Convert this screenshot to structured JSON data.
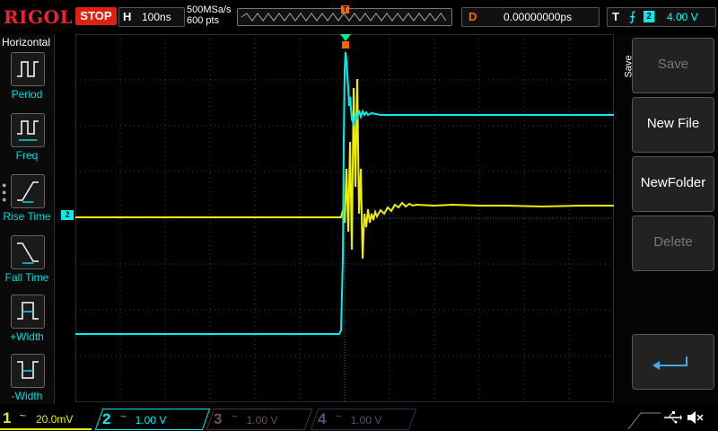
{
  "brand": "RIGOL",
  "run_state": "STOP",
  "horizontal": {
    "label": "H",
    "timebase": "100ns",
    "sample_rate": "500MSa/s",
    "points": "600  pts"
  },
  "trigger_position_marker": "T",
  "delay": {
    "label": "D",
    "value": "0.00000000ps"
  },
  "trigger": {
    "label": "T",
    "edge_icon": "rising-edge-icon",
    "source": "2",
    "level": "4.00 V"
  },
  "left_menu": {
    "title": "Horizontal",
    "items": [
      {
        "label": "Period",
        "icon": "period-icon"
      },
      {
        "label": "Freq",
        "icon": "freq-icon"
      },
      {
        "label": "Rise Time",
        "icon": "rise-time-icon"
      },
      {
        "label": "Fall Time",
        "icon": "fall-time-icon"
      },
      {
        "label": "+Width",
        "icon": "positive-width-icon"
      },
      {
        "label": "-Width",
        "icon": "negative-width-icon"
      }
    ]
  },
  "ch2_marker": "2",
  "right_menu": {
    "title": "Save",
    "items": [
      {
        "label": "Save",
        "enabled": false
      },
      {
        "label": "New File",
        "enabled": true
      },
      {
        "label": "NewFolder",
        "enabled": true
      },
      {
        "label": "Delete",
        "enabled": false
      }
    ],
    "return_icon": "return-arrow-icon"
  },
  "channels": [
    {
      "num": "1",
      "coupling": "~",
      "scale": "20.0mV",
      "color": "#eeee00",
      "active": true
    },
    {
      "num": "2",
      "coupling": "~",
      "scale": "1.00 V",
      "color": "#00eeee",
      "active": true
    },
    {
      "num": "3",
      "coupling": "~",
      "scale": "1.00 V",
      "color": "#665555",
      "active": false
    },
    {
      "num": "4",
      "coupling": "~",
      "scale": "1.00 V",
      "color": "#555577",
      "active": false
    }
  ],
  "status_icons": [
    "usb-icon",
    "speaker-muted-icon"
  ],
  "colors": {
    "ch1": "#eeee00",
    "ch2": "#00eeee",
    "brand": "#ee2233",
    "stop": "#dd1111",
    "delay_label": "#ff6600"
  }
}
